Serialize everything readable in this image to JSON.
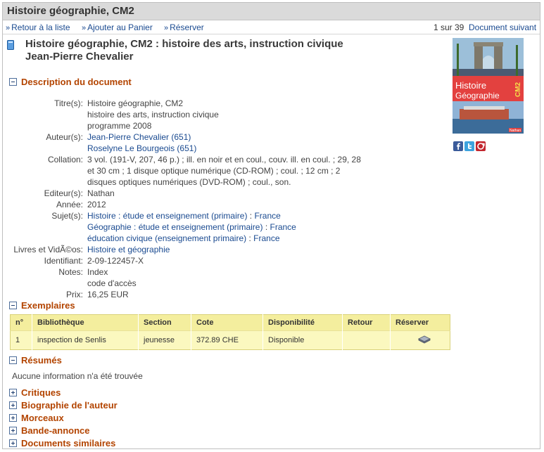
{
  "title_bar": {
    "title": "Histoire géographie, CM2"
  },
  "nav": {
    "back": "Retour à la liste",
    "add_cart": "Ajouter au Panier",
    "reserve": "Réserver",
    "counter": "1 sur 39",
    "next": "Document suivant",
    "bullet": "»"
  },
  "document": {
    "heading_line1": "Histoire géographie, CM2 : histoire des arts, instruction civique",
    "heading_line2": "Jean-Pierre Chevalier"
  },
  "cover": {
    "top_text": "Histoire",
    "mid_text": "Géographie",
    "badge": "CM2",
    "publisher": "Nathan"
  },
  "sections": {
    "description": "Description du document",
    "exemplaires": "Exemplaires",
    "resumes": "Résumés",
    "critiques": "Critiques",
    "biographie": "Biographie de l'auteur",
    "morceaux": "Morceaux",
    "bande_annonce": "Bande-annonce",
    "similaires": "Documents similaires"
  },
  "fields": {
    "titre_label": "Titre(s):",
    "titre": [
      "Histoire géographie, CM2",
      "histoire des arts, instruction civique",
      "programme 2008"
    ],
    "auteur_label": "Auteur(s):",
    "auteurs": [
      "Jean-Pierre Chevalier (651)",
      "Roselyne Le Bourgeois (651)"
    ],
    "collation_label": "Collation:",
    "collation": [
      "3 vol. (191-V, 207, 46 p.) ; ill. en noir et en coul., couv. ill. en coul. ; 29, 28",
      "et 30 cm ; 1 disque optique numérique (CD-ROM) ; coul. ; 12 cm ; 2",
      "disques optiques numériques (DVD-ROM) ; coul., son."
    ],
    "editeur_label": "Editeur(s):",
    "editeur": "Nathan",
    "annee_label": "Année:",
    "annee": "2012",
    "sujet_label": "Sujet(s):",
    "sujets": [
      {
        "main": "Histoire : étude et enseignement (primaire)",
        "sep": " : ",
        "place": "France"
      },
      {
        "main": "Géographie : étude et enseignement (primaire)",
        "sep": " : ",
        "place": "France"
      },
      {
        "main": "éducation civique (enseignement primaire)",
        "sep": " : ",
        "place": "France"
      }
    ],
    "livres_label": "Livres et VidÃ©os:",
    "livres": "Histoire et géographie",
    "identifiant_label": "Identifiant:",
    "identifiant": "2-09-122457-X",
    "notes_label": "Notes:",
    "notes": [
      "Index",
      "code d'accès"
    ],
    "prix_label": "Prix:",
    "prix": "16,25 EUR"
  },
  "exemplaires": {
    "headers": [
      "n°",
      "Bibliothèque",
      "Section",
      "Cote",
      "Disponibilité",
      "Retour",
      "Réserver"
    ],
    "rows": [
      {
        "n": "1",
        "bibliotheque": "inspection de Senlis",
        "section": "jeunesse",
        "cote": "372.89 CHE",
        "disponibilite": "Disponible",
        "retour": ""
      }
    ]
  },
  "resumes": {
    "text": "Aucune information n'a été trouvée"
  },
  "colors": {
    "section_title": "#b34400",
    "link": "#1a4a90",
    "table_bg": "#fbf8bf"
  },
  "icons": [
    "book-icon",
    "facebook-icon",
    "twitter-icon",
    "share-icon",
    "reserve-icon"
  ]
}
